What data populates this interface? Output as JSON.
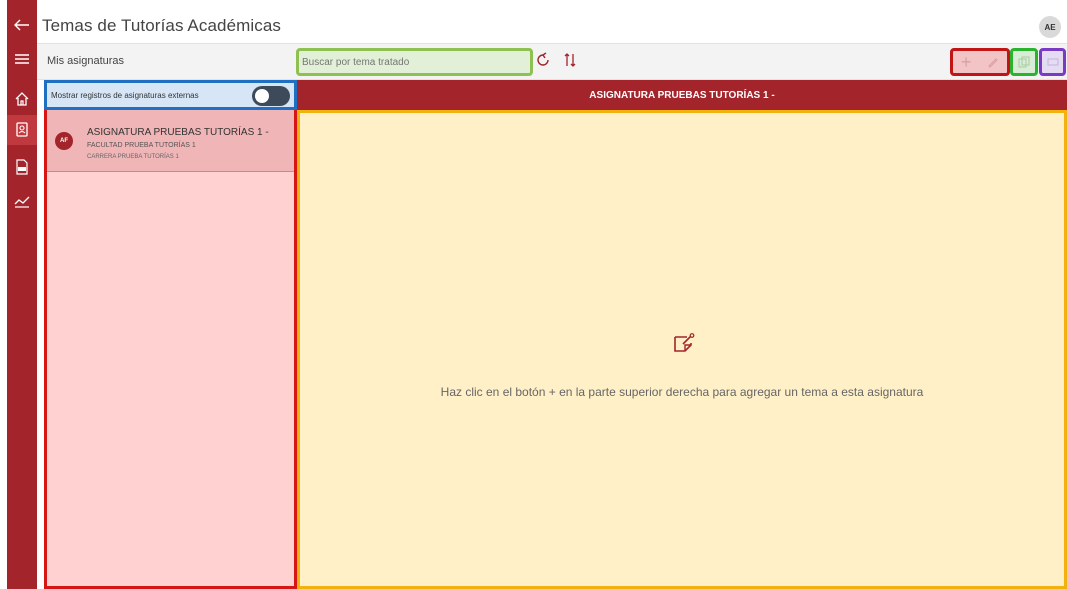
{
  "app": {
    "title": "Temas de Tutorías Académicas",
    "user_initials": "AE",
    "accent_color": "#a3242b"
  },
  "rail": {
    "items": [
      {
        "icon": "back-arrow-icon"
      },
      {
        "icon": "hamburger-icon"
      },
      {
        "icon": "home-icon"
      },
      {
        "icon": "contact-book-icon"
      },
      {
        "icon": "pdf-report-icon"
      },
      {
        "icon": "analytics-icon"
      }
    ]
  },
  "toolbar": {
    "list_title": "Mis asignaturas",
    "search_placeholder": "Buscar por tema tratado",
    "refresh_icon": "refresh-icon",
    "sort_icon": "sort-icon",
    "add_icon": "plus-icon",
    "edit_icon": "pencil-icon",
    "copy_icon": "copy-icon",
    "more_icon": "ellipsis-icon"
  },
  "sidebar": {
    "toggle_label": "Mostrar registros de asignaturas externas",
    "toggle_state": "off",
    "items": [
      {
        "initials": "AF",
        "title": "ASIGNATURA PRUEBAS TUTORÍAS 1 -",
        "faculty": "FACULTAD PRUEBA TUTORÍAS 1",
        "career": "CARRERA PRUEBA TUTORÍAS 1"
      }
    ]
  },
  "detail": {
    "header": "ASIGNATURA PRUEBAS TUTORÍAS 1 -",
    "empty_icon": "note-edit-icon",
    "empty_message": "Haz clic en el botón + en la parte superior derecha para agregar un tema a esta asignatura"
  }
}
